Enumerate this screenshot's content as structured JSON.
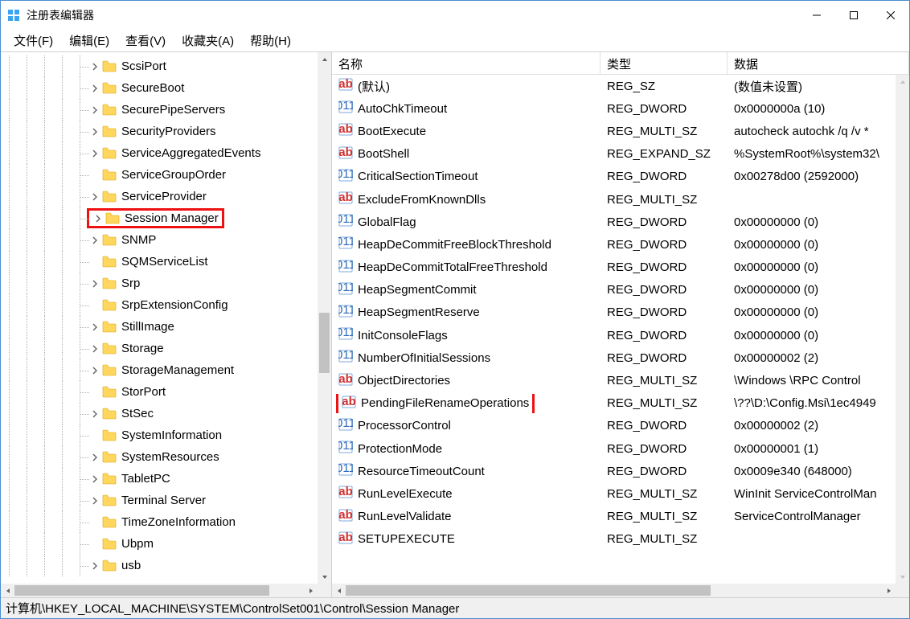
{
  "window": {
    "title": "注册表编辑器"
  },
  "menu": {
    "file": "文件(F)",
    "edit": "编辑(E)",
    "view": "查看(V)",
    "favorites": "收藏夹(A)",
    "help": "帮助(H)"
  },
  "columns": {
    "name": "名称",
    "type": "类型",
    "data": "数据"
  },
  "tree": [
    {
      "label": "ScsiPort",
      "expandable": true
    },
    {
      "label": "SecureBoot",
      "expandable": true
    },
    {
      "label": "SecurePipeServers",
      "expandable": true
    },
    {
      "label": "SecurityProviders",
      "expandable": true
    },
    {
      "label": "ServiceAggregatedEvents",
      "expandable": true
    },
    {
      "label": "ServiceGroupOrder",
      "expandable": false
    },
    {
      "label": "ServiceProvider",
      "expandable": true
    },
    {
      "label": "Session Manager",
      "expandable": true,
      "highlight": true
    },
    {
      "label": "SNMP",
      "expandable": true
    },
    {
      "label": "SQMServiceList",
      "expandable": false
    },
    {
      "label": "Srp",
      "expandable": true
    },
    {
      "label": "SrpExtensionConfig",
      "expandable": false
    },
    {
      "label": "StillImage",
      "expandable": true
    },
    {
      "label": "Storage",
      "expandable": true
    },
    {
      "label": "StorageManagement",
      "expandable": true
    },
    {
      "label": "StorPort",
      "expandable": false
    },
    {
      "label": "StSec",
      "expandable": true
    },
    {
      "label": "SystemInformation",
      "expandable": false
    },
    {
      "label": "SystemResources",
      "expandable": true
    },
    {
      "label": "TabletPC",
      "expandable": true
    },
    {
      "label": "Terminal Server",
      "expandable": true
    },
    {
      "label": "TimeZoneInformation",
      "expandable": false
    },
    {
      "label": "Ubpm",
      "expandable": false
    },
    {
      "label": "usb",
      "expandable": true
    }
  ],
  "values": [
    {
      "icon": "str",
      "name": "(默认)",
      "type": "REG_SZ",
      "data": "(数值未设置)"
    },
    {
      "icon": "bin",
      "name": "AutoChkTimeout",
      "type": "REG_DWORD",
      "data": "0x0000000a (10)"
    },
    {
      "icon": "str",
      "name": "BootExecute",
      "type": "REG_MULTI_SZ",
      "data": "autocheck autochk /q /v *"
    },
    {
      "icon": "str",
      "name": "BootShell",
      "type": "REG_EXPAND_SZ",
      "data": "%SystemRoot%\\system32\\"
    },
    {
      "icon": "bin",
      "name": "CriticalSectionTimeout",
      "type": "REG_DWORD",
      "data": "0x00278d00 (2592000)"
    },
    {
      "icon": "str",
      "name": "ExcludeFromKnownDlls",
      "type": "REG_MULTI_SZ",
      "data": ""
    },
    {
      "icon": "bin",
      "name": "GlobalFlag",
      "type": "REG_DWORD",
      "data": "0x00000000 (0)"
    },
    {
      "icon": "bin",
      "name": "HeapDeCommitFreeBlockThreshold",
      "type": "REG_DWORD",
      "data": "0x00000000 (0)"
    },
    {
      "icon": "bin",
      "name": "HeapDeCommitTotalFreeThreshold",
      "type": "REG_DWORD",
      "data": "0x00000000 (0)"
    },
    {
      "icon": "bin",
      "name": "HeapSegmentCommit",
      "type": "REG_DWORD",
      "data": "0x00000000 (0)"
    },
    {
      "icon": "bin",
      "name": "HeapSegmentReserve",
      "type": "REG_DWORD",
      "data": "0x00000000 (0)"
    },
    {
      "icon": "bin",
      "name": "InitConsoleFlags",
      "type": "REG_DWORD",
      "data": "0x00000000 (0)"
    },
    {
      "icon": "bin",
      "name": "NumberOfInitialSessions",
      "type": "REG_DWORD",
      "data": "0x00000002 (2)"
    },
    {
      "icon": "str",
      "name": "ObjectDirectories",
      "type": "REG_MULTI_SZ",
      "data": "\\Windows \\RPC Control"
    },
    {
      "icon": "str",
      "name": "PendingFileRenameOperations",
      "type": "REG_MULTI_SZ",
      "data": "\\??\\D:\\Config.Msi\\1ec4949",
      "highlight": true
    },
    {
      "icon": "bin",
      "name": "ProcessorControl",
      "type": "REG_DWORD",
      "data": "0x00000002 (2)"
    },
    {
      "icon": "bin",
      "name": "ProtectionMode",
      "type": "REG_DWORD",
      "data": "0x00000001 (1)"
    },
    {
      "icon": "bin",
      "name": "ResourceTimeoutCount",
      "type": "REG_DWORD",
      "data": "0x0009e340 (648000)"
    },
    {
      "icon": "str",
      "name": "RunLevelExecute",
      "type": "REG_MULTI_SZ",
      "data": "WinInit ServiceControlMan"
    },
    {
      "icon": "str",
      "name": "RunLevelValidate",
      "type": "REG_MULTI_SZ",
      "data": "ServiceControlManager"
    },
    {
      "icon": "str",
      "name": "SETUPEXECUTE",
      "type": "REG_MULTI_SZ",
      "data": ""
    }
  ],
  "statusbar": {
    "path": "计算机\\HKEY_LOCAL_MACHINE\\SYSTEM\\ControlSet001\\Control\\Session Manager"
  }
}
